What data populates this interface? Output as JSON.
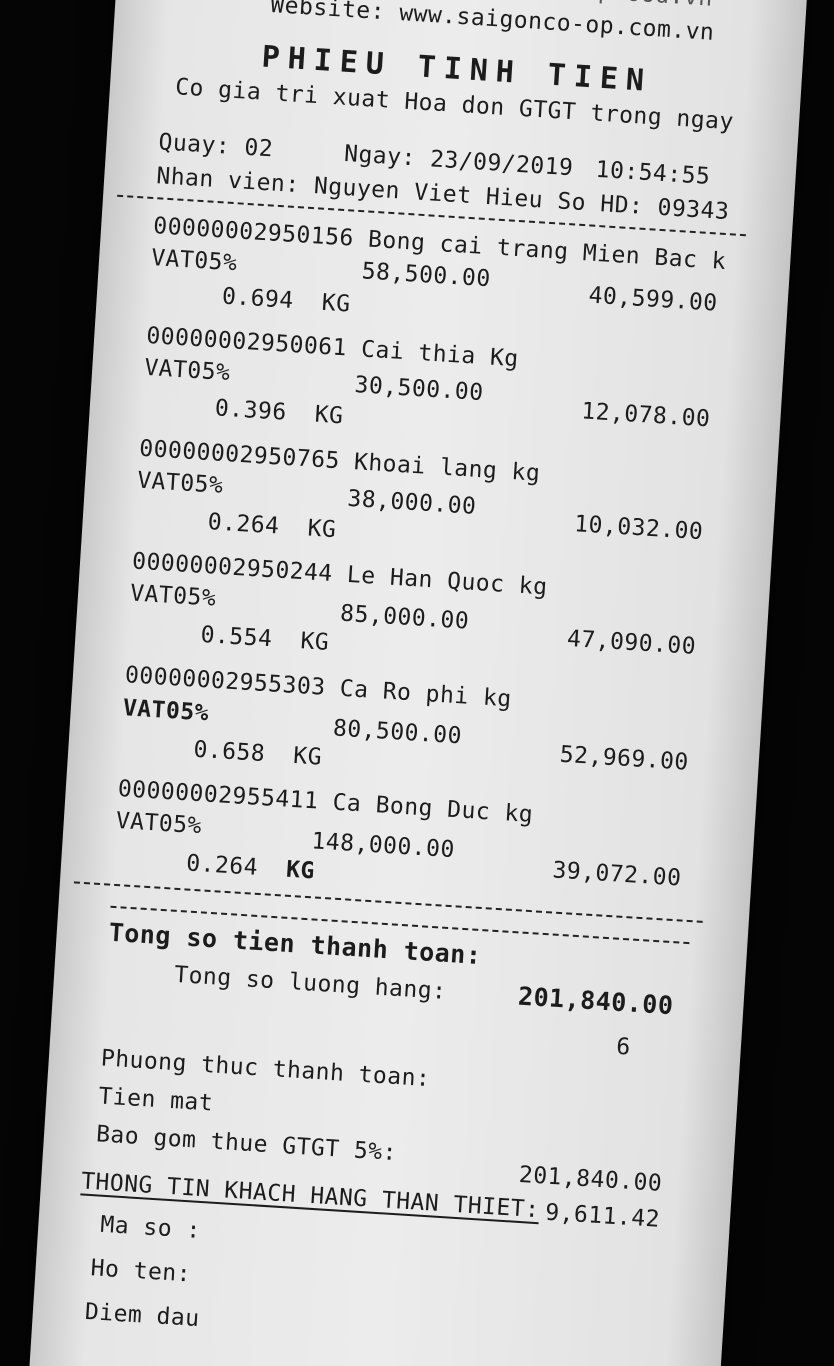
{
  "header": {
    "email": "Email: e.cherpark@coopfood.vn",
    "website": "Website: www.saigonco-op.com.vn",
    "title": "PHIEU TINH TIEN",
    "subtitle": "Co gia tri xuat Hoa don GTGT trong ngay"
  },
  "meta": {
    "counter": "Quay: 02",
    "date": "Ngay: 23/09/2019",
    "time": "10:54:55",
    "staff": "Nhan vien: Nguyen Viet Hieu So HD: 09343"
  },
  "items": [
    {
      "line": "00000002950156 Bong cai trang Mien Bac k",
      "vat": "VAT05%",
      "price": "58,500.00",
      "total": "40,599.00",
      "qty": "0.694",
      "unit": "KG"
    },
    {
      "line": "00000002950061 Cai thia Kg",
      "vat": "VAT05%",
      "price": "30,500.00",
      "total": "12,078.00",
      "qty": "0.396",
      "unit": "KG"
    },
    {
      "line": "00000002950765 Khoai lang kg",
      "vat": "VAT05%",
      "price": "38,000.00",
      "total": "10,032.00",
      "qty": "0.264",
      "unit": "KG"
    },
    {
      "line": "00000002950244 Le Han Quoc kg",
      "vat": "VAT05%",
      "price": "85,000.00",
      "total": "47,090.00",
      "qty": "0.554",
      "unit": "KG"
    },
    {
      "line": "00000002955303 Ca Ro phi kg",
      "vat": "VAT05%",
      "price": "80,500.00",
      "total": "52,969.00",
      "qty": "0.658",
      "unit": "KG"
    },
    {
      "line": "00000002955411 Ca Bong Duc kg",
      "vat": "VAT05%",
      "price": "148,000.00",
      "total": "39,072.00",
      "qty": "0.264",
      "unit": "KG"
    }
  ],
  "summary": {
    "total_label": "Tong so tien thanh toan:",
    "total_value": "201,840.00",
    "count_label": "Tong so luong hang:",
    "count_value": "6",
    "payment_label": "Phuong thuc thanh toan:",
    "payment_method": "Tien mat",
    "payment_value": "201,840.00",
    "vat_label": "Bao gom thue GTGT  5%:",
    "vat_value": "9,611.42"
  },
  "loyalty": {
    "heading": "THONG TIN KHACH HANG THAN THIET:",
    "code_label": "Ma so :",
    "name_label": "Ho ten:",
    "points_label": "Diem dau"
  }
}
